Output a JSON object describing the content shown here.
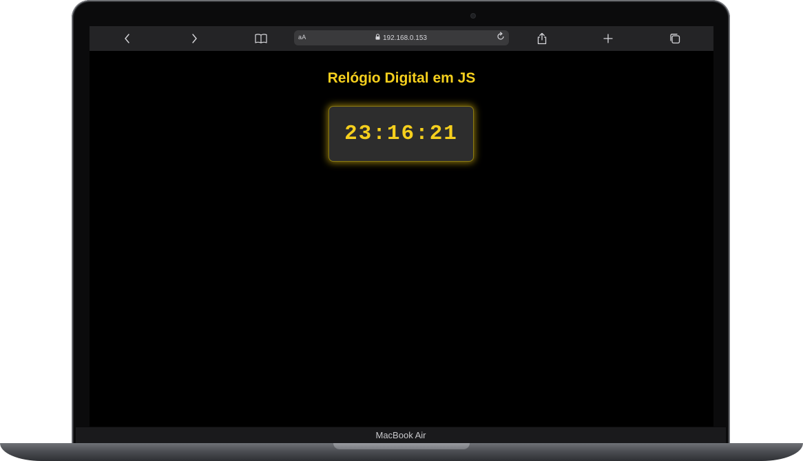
{
  "browser": {
    "text_size_label": "aA",
    "url": "192.168.0.153",
    "icons": {
      "back": "chevron-left-icon",
      "forward": "chevron-right-icon",
      "bookmarks": "book-icon",
      "lock": "lock-icon",
      "reload": "reload-icon",
      "share": "share-icon",
      "new_tab": "plus-icon",
      "tabs": "tabs-icon"
    }
  },
  "page": {
    "title": "Relógio Digital em JS",
    "clock": "23:16:21"
  },
  "device": {
    "model": "MacBook Air"
  },
  "colors": {
    "accent": "#f5cf1d",
    "clock_background": "#2d2d2d",
    "page_background": "#000000",
    "toolbar_background": "#242426"
  }
}
